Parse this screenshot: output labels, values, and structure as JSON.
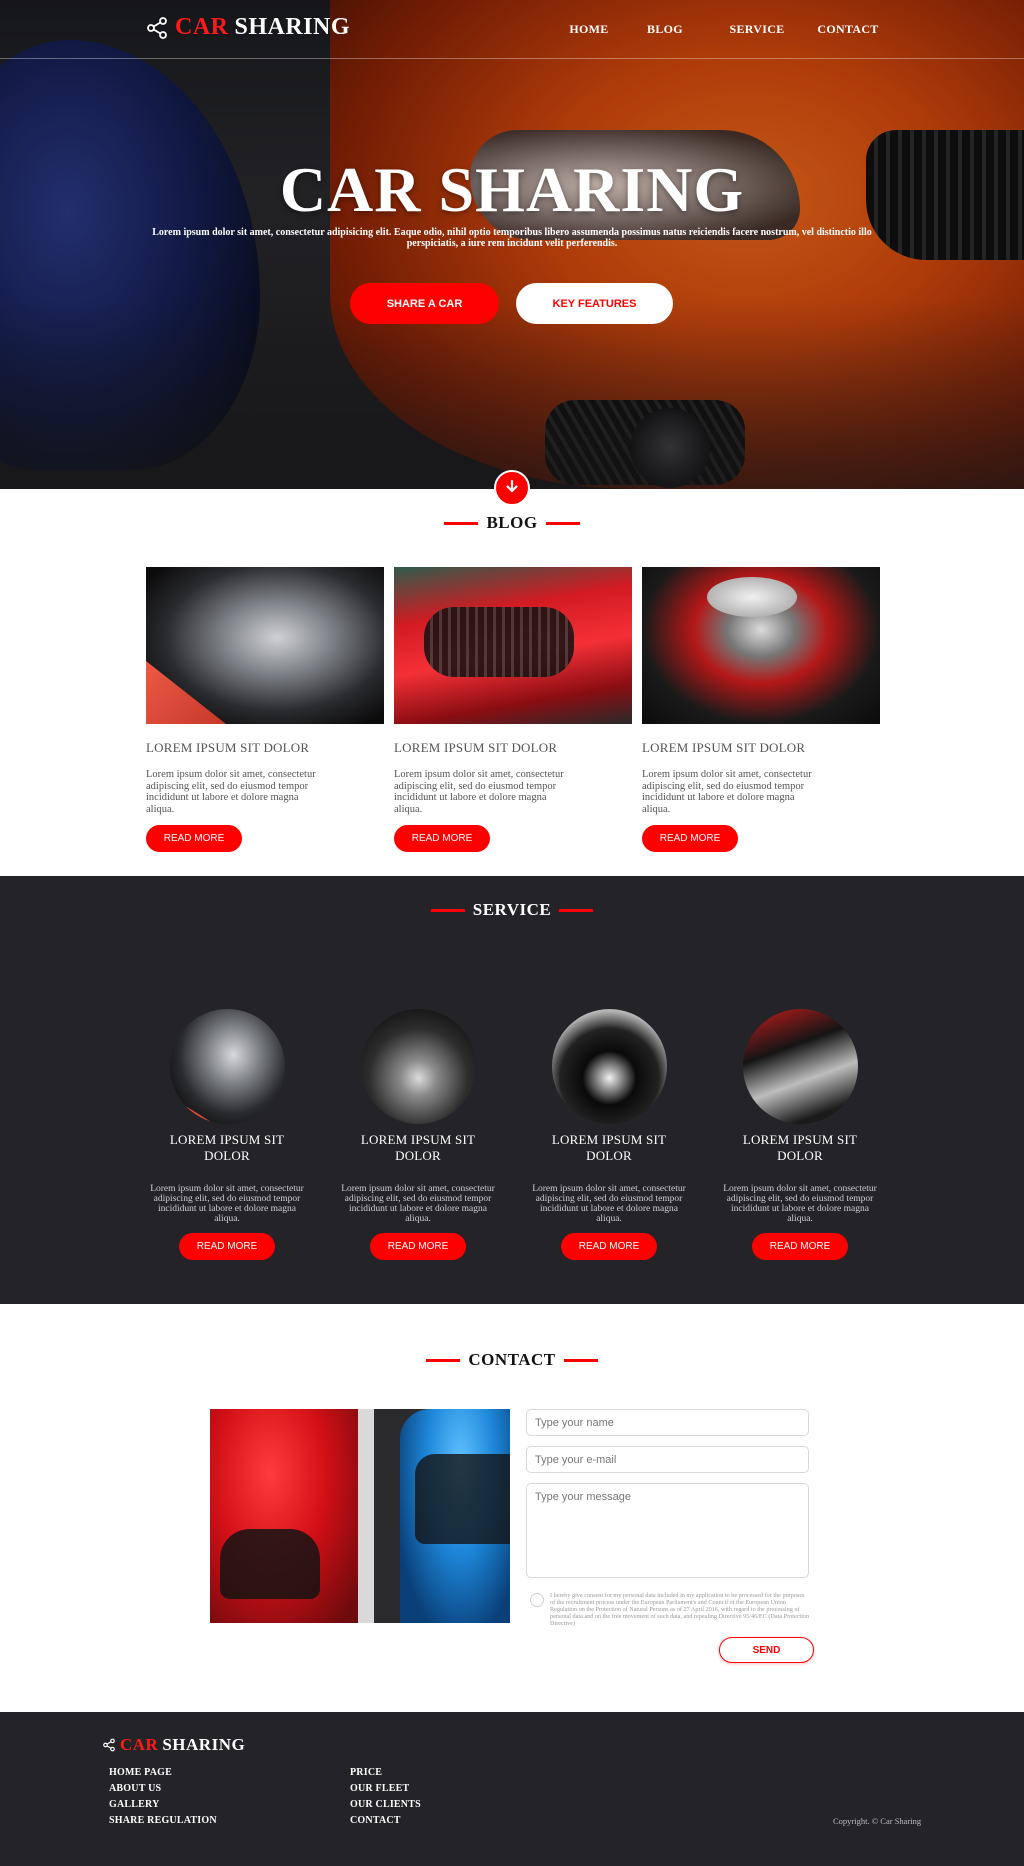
{
  "header": {
    "logo_car": "CAR",
    "logo_sharing": "SHARING",
    "nav": [
      "HOME",
      "BLOG",
      "SERVICE",
      "CONTACT"
    ]
  },
  "hero": {
    "title": "CAR SHARING",
    "subtitle": "Lorem ipsum dolor sit amet, consectetur adipisicing elit. Eaque odio, nihil optio temporibus libero assumenda possimus natus reiciendis facere nostrum, vel distinctio illo perspiciatis, a iure rem incidunt velit perferendis.",
    "btn_share": "SHARE A CAR",
    "btn_features": "KEY FEATURES"
  },
  "blog": {
    "title": "BLOG",
    "posts": [
      {
        "heading": "LOREM IPSUM SIT DOLOR",
        "text": "Lorem ipsum dolor sit amet, consectetur adipiscing elit, sed do eiusmod tempor incididunt ut labore et dolore magna aliqua.",
        "button": "READ MORE"
      },
      {
        "heading": "LOREM IPSUM SIT DOLOR",
        "text": "Lorem ipsum dolor sit amet, consectetur adipiscing elit, sed do eiusmod tempor incididunt ut labore et dolore magna aliqua.",
        "button": "READ MORE"
      },
      {
        "heading": "LOREM IPSUM SIT DOLOR",
        "text": "Lorem ipsum dolor sit amet, consectetur adipiscing elit, sed do eiusmod tempor incididunt ut labore et dolore magna aliqua.",
        "button": "READ MORE"
      }
    ]
  },
  "service": {
    "title": "SERVICE",
    "items": [
      {
        "heading": "LOREM IPSUM SIT DOLOR",
        "text": "Lorem ipsum dolor sit amet, consectetur adipiscing elit, sed do eiusmod tempor incididunt ut labore et dolore magna aliqua.",
        "button": "READ MORE"
      },
      {
        "heading": "LOREM IPSUM SIT DOLOR",
        "text": "Lorem ipsum dolor sit amet, consectetur adipiscing elit, sed do eiusmod tempor incididunt ut labore et dolore magna aliqua.",
        "button": "READ MORE"
      },
      {
        "heading": "LOREM IPSUM SIT DOLOR",
        "text": "Lorem ipsum dolor sit amet, consectetur adipiscing elit, sed do eiusmod tempor incididunt ut labore et dolore magna aliqua.",
        "button": "READ MORE"
      },
      {
        "heading": "LOREM IPSUM SIT DOLOR",
        "text": "Lorem ipsum dolor sit amet, consectetur adipiscing elit, sed do eiusmod tempor incididunt ut labore et dolore magna aliqua.",
        "button": "READ MORE"
      }
    ]
  },
  "contact": {
    "title": "CONTACT",
    "name_placeholder": "Type your name",
    "email_placeholder": "Type your e-mail",
    "message_placeholder": "Type your message",
    "consent_text": "I hereby give consent for my personal data included in my application to be processed for the purposes of the recruitment process under the European Parliament's and Council of the European Union Regulation on the Protection of Natural Persons as of 27 April 2016, with regard to the processing of personal data and on the free movement of such data, and repealing Directive 95/46/EC (Data Protection Directive)",
    "send": "SEND"
  },
  "footer": {
    "logo_car": "CAR",
    "logo_sharing": "SHARING",
    "col1": [
      "HOME PAGE",
      "ABOUT US",
      "GALLERY",
      "SHARE REGULATION"
    ],
    "col2": [
      "PRICE",
      "OUR FLEET",
      "OUR CLIENTS",
      "CONTACT"
    ],
    "copyright": "Copyright. © Car Sharing"
  },
  "colors": {
    "accent": "#ff0000",
    "dark_section": "#242328"
  },
  "icons": {
    "logo": "share-icon",
    "scroll": "arrow-down-icon"
  }
}
